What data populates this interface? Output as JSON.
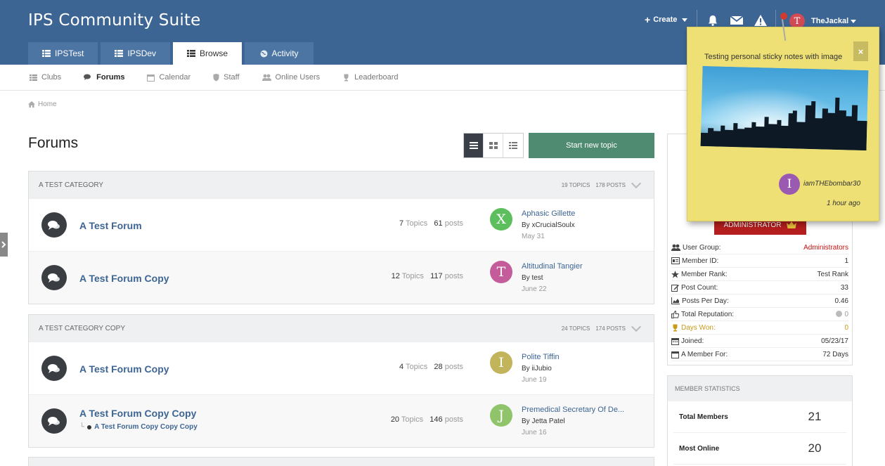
{
  "header": {
    "brand": "IPS Community Suite",
    "create_label": "Create",
    "username": "TheJackal",
    "user_initial": "T",
    "tabs": [
      {
        "label": "IPSTest",
        "icon": "list-icon",
        "active": false
      },
      {
        "label": "IPSDev",
        "icon": "list-icon",
        "active": false
      },
      {
        "label": "Browse",
        "icon": "list-icon",
        "active": true
      },
      {
        "label": "Activity",
        "icon": "globe-icon",
        "active": false
      }
    ]
  },
  "subnav": {
    "items": [
      {
        "label": "Clubs",
        "icon": "list-icon"
      },
      {
        "label": "Forums",
        "icon": "comments-icon",
        "active": true
      },
      {
        "label": "Calendar",
        "icon": "calendar-icon"
      },
      {
        "label": "Staff",
        "icon": "shield-icon"
      },
      {
        "label": "Online Users",
        "icon": "users-icon"
      },
      {
        "label": "Leaderboard",
        "icon": "trophy-icon"
      }
    ]
  },
  "breadcrumb": {
    "home": "Home"
  },
  "page": {
    "title": "Forums",
    "start_topic": "Start new topic"
  },
  "categories": [
    {
      "title": "A Test Category",
      "topics": "19 TOPICS",
      "posts": "178 POSTS",
      "forums": [
        {
          "name": "A Test Forum",
          "topics_num": "7",
          "topics_lbl": "Topics",
          "posts_num": "61",
          "posts_lbl": "posts",
          "last_title": "Aphasic Gillette",
          "last_by": "By xCrucialSoulx",
          "last_date": "May 31",
          "avatar_letter": "X",
          "avatar_color": "#5dbe5d"
        },
        {
          "name": "A Test Forum Copy",
          "topics_num": "12",
          "topics_lbl": "Topics",
          "posts_num": "117",
          "posts_lbl": "posts",
          "last_title": "Altitudinal Tangier",
          "last_by": "By test",
          "last_date": "June 22",
          "avatar_letter": "T",
          "avatar_color": "#c45b9b"
        }
      ]
    },
    {
      "title": "A Test Category Copy",
      "topics": "24 TOPICS",
      "posts": "174 POSTS",
      "forums": [
        {
          "name": "A Test Forum Copy",
          "topics_num": "4",
          "topics_lbl": "Topics",
          "posts_num": "28",
          "posts_lbl": "posts",
          "last_title": "Polite Tiffin",
          "last_by": "By iiJubio",
          "last_date": "June 19",
          "avatar_letter": "I",
          "avatar_color": "#c2b45a"
        },
        {
          "name": "A Test Forum Copy Copy",
          "subforum": "A Test Forum Copy Copy Copy",
          "topics_num": "20",
          "topics_lbl": "Topics",
          "posts_num": "146",
          "posts_lbl": "posts",
          "last_title": "Premedical Secretary Of De...",
          "last_by": "By Jetta Patel",
          "last_date": "June 16",
          "avatar_letter": "J",
          "avatar_color": "#8fc46a"
        }
      ]
    }
  ],
  "profile": {
    "badge": "ADMINISTRATOR",
    "stats": [
      {
        "label": "User Group:",
        "value": "Administrators",
        "icon": "users-icon"
      },
      {
        "label": "Member ID:",
        "value": "1",
        "icon": "id-card-icon"
      },
      {
        "label": "Member Rank:",
        "value": "Test Rank",
        "icon": "star-icon"
      },
      {
        "label": "Post Count:",
        "value": "33",
        "icon": "edit-icon"
      },
      {
        "label": "Posts Per Day:",
        "value": "0.46",
        "icon": "area-chart-icon"
      },
      {
        "label": "Total Reputation:",
        "value": "0",
        "icon": "thumbs-up-icon"
      },
      {
        "label": "Days Won:",
        "value": "0",
        "icon": "trophy-icon"
      },
      {
        "label": "Joined:",
        "value": "05/23/17",
        "icon": "calendar-icon"
      },
      {
        "label": "A Member For:",
        "value": "72 Days",
        "icon": "calendar-icon"
      }
    ]
  },
  "member_stats": {
    "title": "Member Statistics",
    "rows": [
      {
        "label": "Total Members",
        "value": "21"
      },
      {
        "label": "Most Online",
        "value": "20"
      }
    ]
  },
  "sticky_note": {
    "text": "Testing personal sticky notes with image",
    "close": "×",
    "author": "iamTHEbombar30",
    "author_initial": "I",
    "time": "1 hour ago"
  },
  "colors": {
    "header_bg": "#3d6594",
    "accent_green": "#4f8b71",
    "admin_red": "#b51e1e",
    "sticky_yellow": "#eee075"
  }
}
